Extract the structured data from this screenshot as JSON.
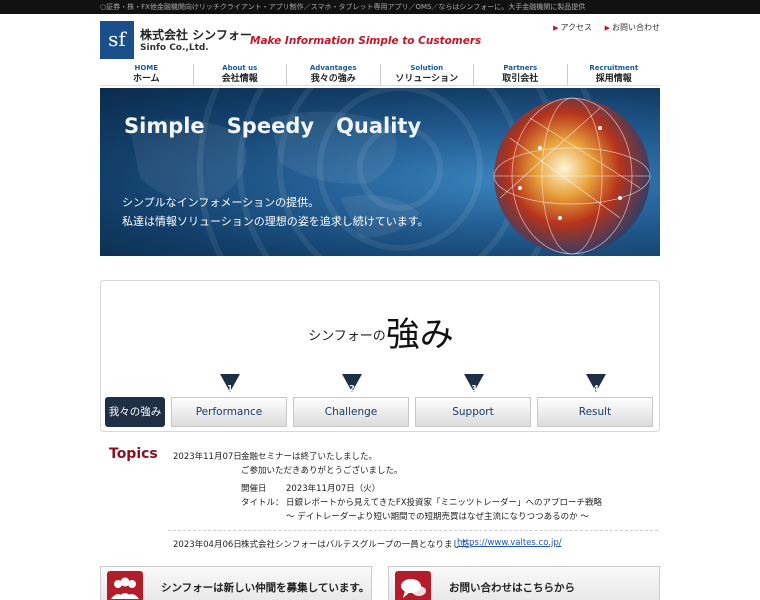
{
  "topbar": {
    "ticker": "○証券・株・FX他金融機関向けリッチクライアント・アプリ制作／スマホ・タブレット専用アプリ／OMS／ならはシンフォーに。大手金融機関に製品提供"
  },
  "header": {
    "logo_mark": "sf",
    "company_jp": "株式会社 シンフォー",
    "company_en": "Sinfo Co.,Ltd.",
    "slogan": "Make Information Simple to Customers",
    "links": [
      {
        "label": "アクセス"
      },
      {
        "label": "お問い合わせ"
      }
    ]
  },
  "nav": [
    {
      "en": "HOME",
      "jp": "ホーム"
    },
    {
      "en": "About us",
      "jp": "会社情報"
    },
    {
      "en": "Advantages",
      "jp": "我々の強み"
    },
    {
      "en": "Solution",
      "jp": "ソリューション"
    },
    {
      "en": "Partners",
      "jp": "取引会社"
    },
    {
      "en": "Recruitment",
      "jp": "採用情報"
    }
  ],
  "hero": {
    "words": [
      "Simple",
      "Speedy",
      "Quality"
    ],
    "desc1": "シンプルなインフォメーションの提供。",
    "desc2": "私達は情報ソリューションの理想の姿を追求し続けています。"
  },
  "strength": {
    "title_prefix": "シンフォーの",
    "title_big": "強み",
    "active_tab": "我々の強み",
    "tabs": [
      {
        "num": "1",
        "label": "Performance"
      },
      {
        "num": "2",
        "label": "Challenge"
      },
      {
        "num": "3",
        "label": "Support"
      },
      {
        "num": "4",
        "label": "Result"
      }
    ]
  },
  "topics": {
    "heading": "Topics",
    "item1": {
      "date": "2023年11月07日",
      "line1": "金融セミナーは終了いたしました。",
      "line2": "ご参加いただきありがとうございました。",
      "held_label": "開催日",
      "held_value": "2023年11月07日（火）",
      "title_label": "タイトル：",
      "title_value": "日銀レポートから見えてきたFX投資家「ミニッツトレーダー」へのアプローチ戦略",
      "subtitle": "～ デイトレーダーより短い期間での短期売買はなぜ主流になりつつあるのか ～"
    },
    "item2": {
      "date": "2023年04月06日",
      "text": "株式会社シンフォーはバルテスグループの一員となりました。",
      "link": "https://www.valtes.co.jp/"
    }
  },
  "panels": {
    "recruit": "シンフォーは新しい仲間を募集しています。",
    "contact": "お問い合わせはこちらから"
  },
  "colors": {
    "accent": "#c0162a",
    "nav_en": "#1a5aa0",
    "hero": "#245f94",
    "active_tab": "#1f3046"
  }
}
